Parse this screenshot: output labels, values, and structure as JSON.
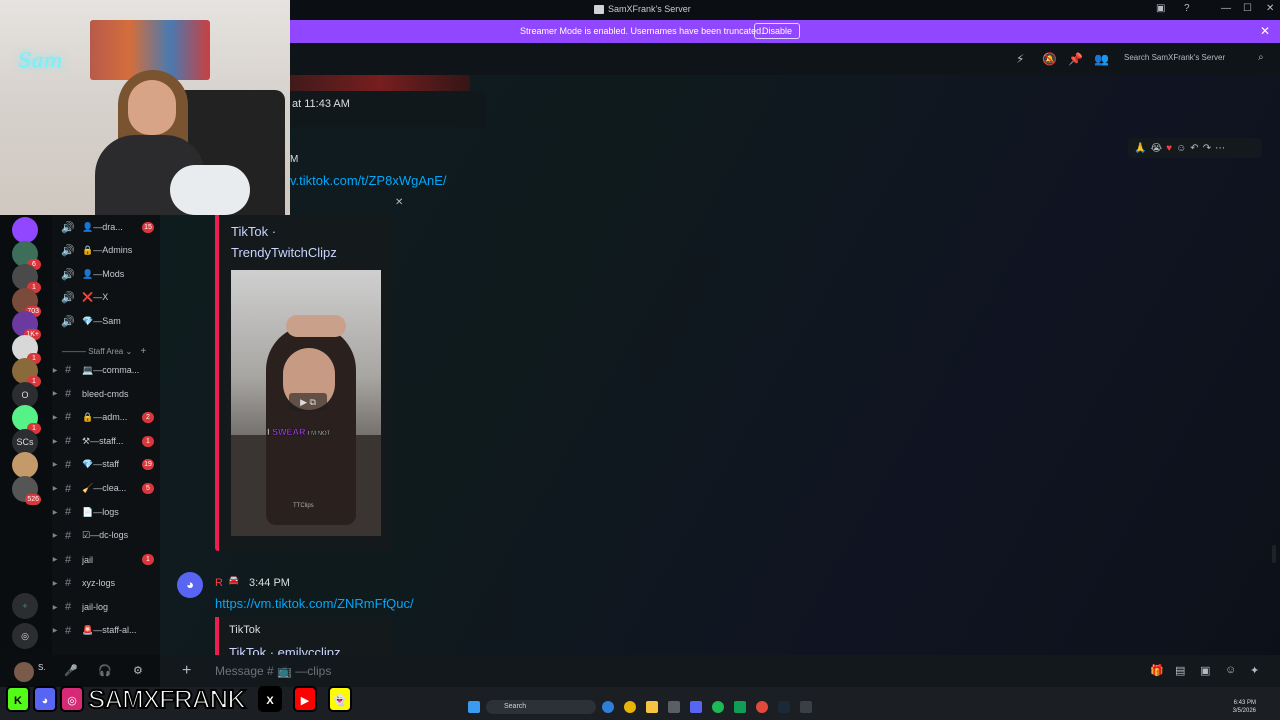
{
  "window": {
    "title": "SamXFrank's Server"
  },
  "streamer": {
    "message": "Streamer Mode is enabled. Usernames have been truncated.",
    "disable_label": "Disable"
  },
  "topbar": {
    "search_placeholder": "Search SamXFrank's Server"
  },
  "messages": {
    "m1_time": "at 11:43 AM",
    "m2_time": "M",
    "m2_link": "v.tiktok.com/t/ZP8xWgAnE/",
    "embed1_provider": "TikTok ·",
    "embed1_author": "TrendyTwitchClipz",
    "embed1_caption_hl": "SWEAR",
    "embed1_caption_pre": "I",
    "embed1_caption_post": "I'M NOT.",
    "embed1_watermark": "TTClips",
    "m3_author": "R",
    "m3_time": "3:44 PM",
    "m3_link": "https://vm.tiktok.com/ZNRmFfQuc/",
    "embed2_provider": "TikTok",
    "embed2_author": "TikTok · emilycclipz"
  },
  "composer": {
    "placeholder": "Message # 📺 —clips"
  },
  "servers": [
    {
      "label": "",
      "color": "#9146ff",
      "badge": ""
    },
    {
      "label": "",
      "color": "#3c6e5a",
      "badge": "6"
    },
    {
      "label": "",
      "color": "#4a4a4a",
      "badge": "1"
    },
    {
      "label": "",
      "color": "#7a4a3a",
      "badge": "703"
    },
    {
      "label": "",
      "color": "#6a3aa0",
      "badge": "1K+"
    },
    {
      "label": "",
      "color": "#d8d8d8",
      "badge": "1"
    },
    {
      "label": "",
      "color": "#8a6a3a",
      "badge": "1"
    },
    {
      "label": "O",
      "color": "#2b2d31",
      "badge": ""
    },
    {
      "label": "",
      "color": "#57f287",
      "badge": "1"
    },
    {
      "label": "SCs",
      "color": "#2b2d31",
      "badge": ""
    },
    {
      "label": "",
      "color": "#c49a6a",
      "badge": ""
    },
    {
      "label": "",
      "color": "#555555",
      "badge": "526"
    }
  ],
  "channels": [
    {
      "icon": "🔊",
      "name": "👤—dra...",
      "badge": "15",
      "arrow": false
    },
    {
      "icon": "🔊",
      "name": "🔒—Admins",
      "badge": "",
      "arrow": false
    },
    {
      "icon": "🔊",
      "name": "👤—Mods",
      "badge": "",
      "arrow": false
    },
    {
      "icon": "🔊",
      "name": "❌—X",
      "badge": "",
      "arrow": false
    },
    {
      "icon": "🔊",
      "name": "💎—Sam",
      "badge": "",
      "arrow": false
    }
  ],
  "staff_category": "Staff Area",
  "staff_channels": [
    {
      "name": "💻—comma...",
      "badge": ""
    },
    {
      "name": "bleed-cmds",
      "badge": ""
    },
    {
      "name": "🔒—adm...",
      "badge": "2"
    },
    {
      "name": "⚒—staff...",
      "badge": "1"
    },
    {
      "name": "💎—staff",
      "badge": "19"
    },
    {
      "name": "🧹—clea...",
      "badge": "5"
    },
    {
      "name": "📄—logs",
      "badge": ""
    },
    {
      "name": "☑—dc-logs",
      "badge": ""
    },
    {
      "name": "jail",
      "badge": "1"
    },
    {
      "name": "xyz-logs",
      "badge": ""
    },
    {
      "name": "jail-log",
      "badge": ""
    },
    {
      "name": "🚨—staff-al...",
      "badge": ""
    }
  ],
  "user_panel": {
    "name": "S."
  },
  "overlay": {
    "brand": "SAMXFRANK",
    "webcam_neon": "Sam"
  },
  "taskbar": {
    "search": "Search",
    "time": "6:43 PM",
    "date": "3/5/2026"
  }
}
